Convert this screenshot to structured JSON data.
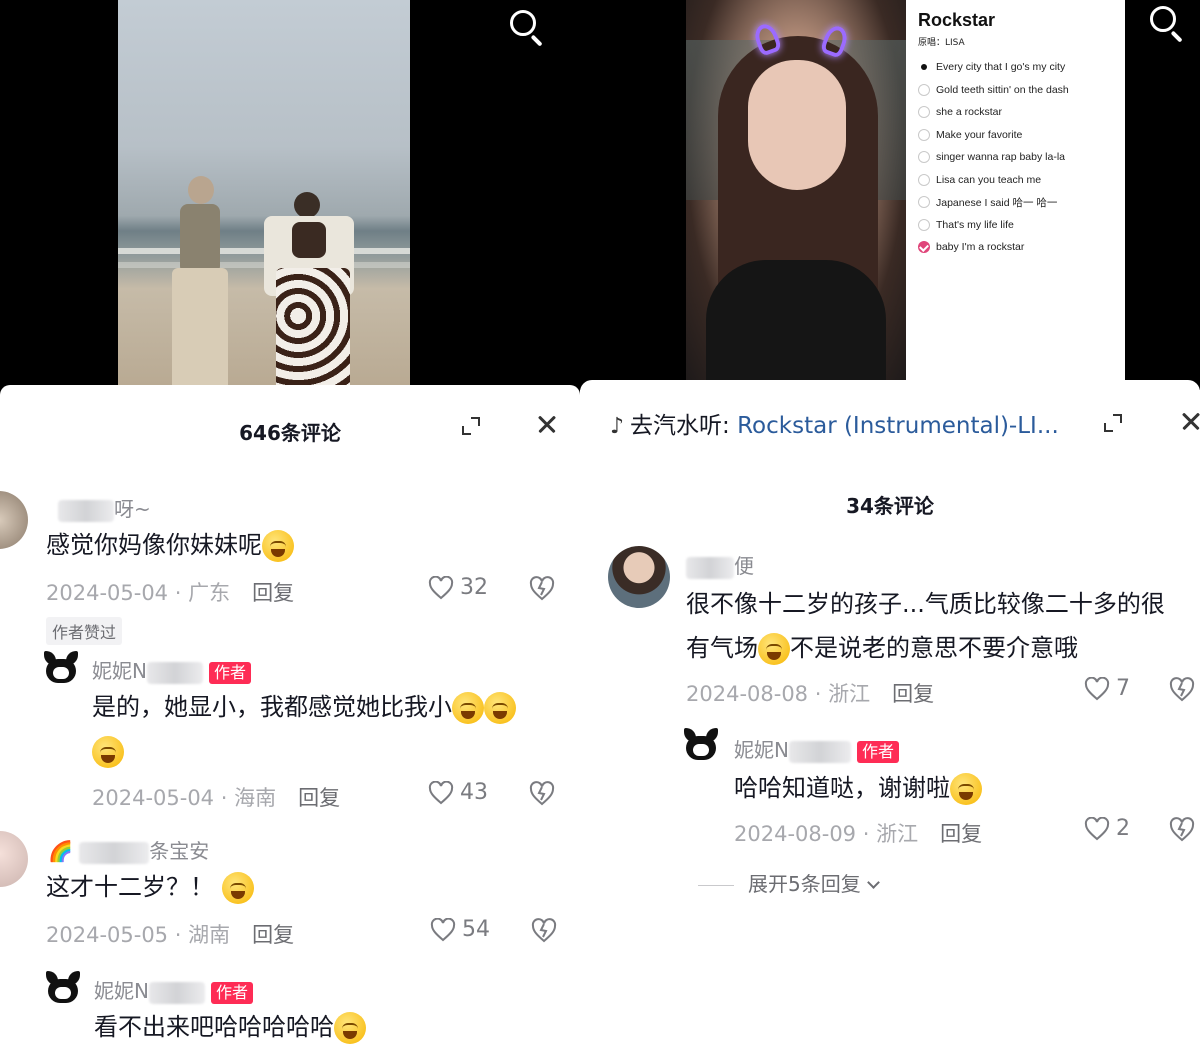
{
  "left": {
    "comment_count_title": "646条评论",
    "comments": [
      {
        "nick": "呀~",
        "text": "感觉你妈像你妹妹呢",
        "date": "2024-05-04",
        "location": "广东",
        "reply": "回复",
        "likes": "32",
        "liked_tag": "作者赞过"
      },
      {
        "nick": "妮妮N",
        "badge": "作者",
        "text_line1": "是的，她显小，我都感觉她比我小",
        "date": "2024-05-04",
        "location": "海南",
        "reply": "回复",
        "likes": "43"
      },
      {
        "nick": "条宝安",
        "text": "这才十二岁？！",
        "date": "2024-05-05",
        "location": "湖南",
        "reply": "回复",
        "likes": "54"
      },
      {
        "nick": "妮妮N",
        "badge": "作者",
        "text": "看不出来吧哈哈哈哈哈"
      }
    ]
  },
  "right": {
    "lyrics": {
      "title": "Rockstar",
      "subtitle": "原唱：LISA",
      "lines": [
        "Every city that I go's my city",
        "Gold teeth sittin' on the dash",
        "she a rockstar",
        "Make your favorite",
        "singer wanna rap baby la-la",
        "Lisa can you teach me",
        "Japanese I said 哈一 哈一",
        "That's my life life",
        "baby I'm a rockstar"
      ]
    },
    "song_prefix": "去汽水听:",
    "song_name": "Rockstar (Instrumental)-LI...",
    "comment_count_title": "34条评论",
    "comments": [
      {
        "nick": "便",
        "text_line1": "很不像十二岁的孩子...气质比较像二十多的很",
        "text_line2": "有气场",
        "text_line2b": "不是说老的意思不要介意哦",
        "date": "2024-08-08",
        "location": "浙江",
        "reply": "回复",
        "likes": "7"
      },
      {
        "nick": "妮妮N",
        "badge": "作者",
        "text": "哈哈知道哒，谢谢啦",
        "date": "2024-08-09",
        "location": "浙江",
        "reply": "回复",
        "likes": "2"
      }
    ],
    "expand_replies": "展开5条回复"
  }
}
